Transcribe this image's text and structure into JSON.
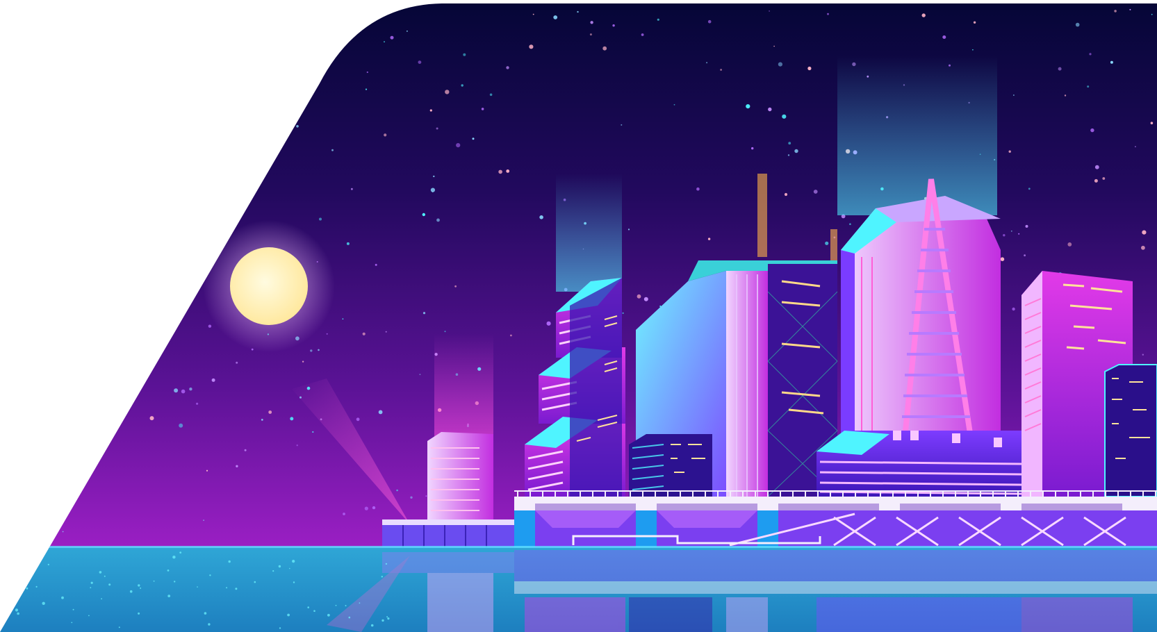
{
  "scene": {
    "subject": "night-city-skyline",
    "colors": {
      "page_background": "#ffffff",
      "sky_top": "#050636",
      "sky_mid": "#3a0b7a",
      "sky_horizon": "#9b1fc4",
      "water_top": "#2a9fd0",
      "water_bottom": "#1e88c4",
      "moon": "#fff2b0",
      "moon_glow": "#f3c6ff",
      "neon_pink": "#ff4fe0",
      "neon_cyan": "#4ff4ff",
      "neon_violet": "#a455ff",
      "window_gold": "#ffd989",
      "bridge_white": "#f4eefc",
      "deck_blue": "#1e9cf0"
    },
    "elements": [
      "moon",
      "stars",
      "skyscrapers",
      "light-beams",
      "bridge",
      "pier",
      "water-reflection"
    ]
  }
}
